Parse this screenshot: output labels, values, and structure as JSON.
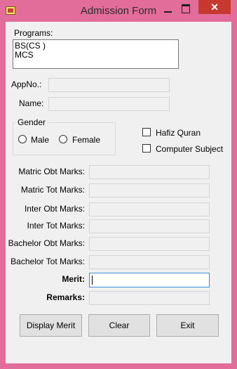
{
  "window": {
    "title": "Admission Form",
    "close_glyph": "✕"
  },
  "programs": {
    "label": "Programs:",
    "items": [
      "BS(CS )",
      "MCS"
    ]
  },
  "app_no": {
    "label": "AppNo.:",
    "value": ""
  },
  "name": {
    "label": "Name:",
    "value": ""
  },
  "gender": {
    "label": "Gender",
    "options": [
      "Male",
      "Female"
    ]
  },
  "checks": {
    "hafiz": "Hafiz Quran",
    "computer": "Computer Subject"
  },
  "marks": {
    "matric_obt": "Matric Obt Marks:",
    "matric_tot": "Matric Tot Marks:",
    "inter_obt": "Inter Obt Marks:",
    "inter_tot": "Inter Tot Marks:",
    "bach_obt": "Bachelor Obt Marks:",
    "bach_tot": "Bachelor Tot Marks:"
  },
  "merit": {
    "label": "Merit:",
    "value": ""
  },
  "remarks": {
    "label": "Remarks:",
    "value": ""
  },
  "buttons": {
    "display_merit": "Display Merit",
    "clear": "Clear",
    "exit": "Exit"
  },
  "colors": {
    "frame": "#e36d9a",
    "client": "#f0f0f0",
    "close": "#c7392e",
    "focus": "#3b8ed9"
  }
}
